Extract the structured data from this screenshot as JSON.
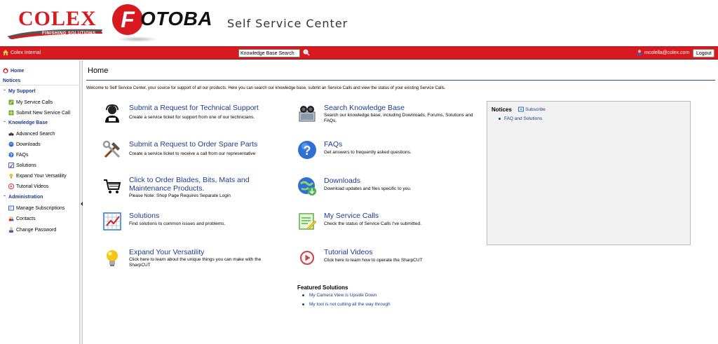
{
  "header": {
    "colex_logo": "COLEX",
    "colex_tagline": "FINISHING SOLUTIONS",
    "fotoba_logo": "FOTOBA",
    "site_title": "Self Service Center"
  },
  "topbar": {
    "org_label": "Colex Internal",
    "search_value": "Knowledge Base Search",
    "user_email": "mcolella@colex.com",
    "logout_label": "Logout"
  },
  "sidebar": {
    "home": "Home",
    "notices": "Notices",
    "my_support": "My Support",
    "my_service_calls": "My Service Calls",
    "submit_new_service_call": "Submit New Service Call",
    "knowledge_base": "Knowledge Base",
    "advanced_search": "Advanced Search",
    "downloads": "Downloads",
    "faqs": "FAQs",
    "solutions": "Solutions",
    "expand_versatility": "Expand Your Versatility",
    "tutorial_videos": "Tutorial Videos",
    "administration": "Administration",
    "manage_subscriptions": "Manage Subscriptions",
    "contacts": "Contacts",
    "change_password": "Change Password"
  },
  "main": {
    "title": "Home",
    "welcome": "Welcome to Self Service Center, your source for support of all our products. Here you can search our knowledge base, submit an Service Calls and view the status of your existing Service Calls.",
    "tiles": {
      "tech_support": {
        "title": "Submit a Request for Technical Support",
        "desc": "Create a service ticket for support from one of our technicians."
      },
      "spare_parts": {
        "title": "Submit a Request to Order Spare Parts",
        "desc": "Create a service ticket to receive a call from our representative"
      },
      "order_blades": {
        "title1": "Click to Order Blades, Bits, Mats and",
        "title2": "Maintenance Products.",
        "desc": "Please Note: Shop Page Requires Separate Login"
      },
      "solutions": {
        "title": "Solutions",
        "desc": "Find solutions to common issues and problems."
      },
      "versatility": {
        "title": "Expand Your Versatility",
        "desc1": "Click here to learn about the unique things you can make with the",
        "desc2": "SharpCUT"
      },
      "search_kb": {
        "title": "Search Knowledge Base",
        "desc1": "Search our knowledge base, including Downloads, Forums, Solutions and",
        "desc2": "FAQs."
      },
      "faqs": {
        "title": "FAQs",
        "desc": "Get answers to frequently asked questions."
      },
      "downloads": {
        "title": "Downloads",
        "desc": "Download updates and files specific to you."
      },
      "service_calls": {
        "title": "My Service Calls",
        "desc": "Check the status of Service Calls I've submitted."
      },
      "tutorials": {
        "title": "Tutorial Videos",
        "desc": "Click here to learn how to operate the SharpCUT"
      }
    },
    "featured": {
      "heading": "Featured Solutions",
      "items": [
        "My Camera View is Upside Down",
        "My tool is not cutting all the way through"
      ]
    },
    "notices_box": {
      "title": "Notices",
      "subscribe": "Subscribe",
      "items": [
        "FAQ and Solutions"
      ]
    }
  },
  "colors": {
    "brand_red": "#d71920",
    "link_blue": "#1a3b8f"
  }
}
